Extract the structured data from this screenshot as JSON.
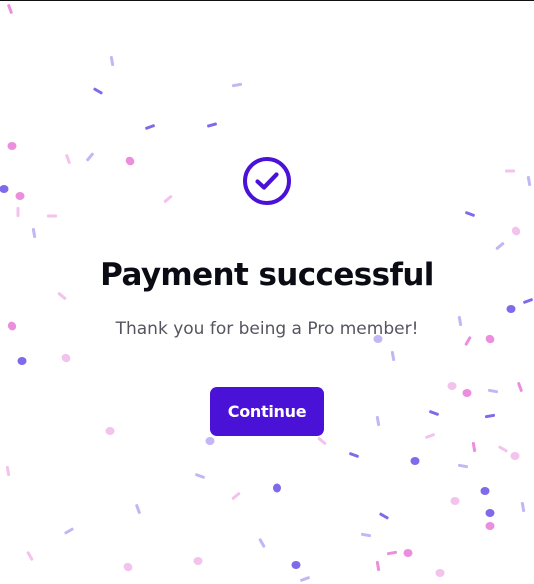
{
  "dialog": {
    "title": "Payment successful",
    "subtitle": "Thank you for being a Pro member!",
    "continue_label": "Continue"
  },
  "colors": {
    "accent": "#4a12d6",
    "title_text": "#0b0b14",
    "subtitle_text": "#55555f",
    "confetti": [
      "#6a4fe6",
      "#e97ad8",
      "#b8a9f3",
      "#f0b8ea",
      "#5140c8",
      "#d9c9fb"
    ]
  },
  "icons": {
    "success": "check-circle-icon"
  }
}
